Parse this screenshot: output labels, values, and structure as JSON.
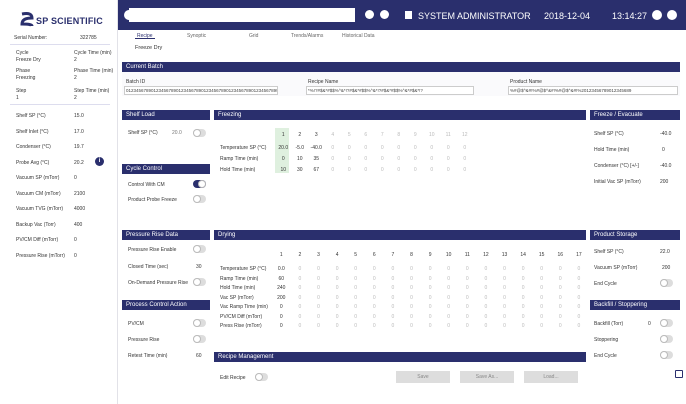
{
  "brand": {
    "name": "SP SCIENTIFIC",
    "serial_label": "Serial Number:",
    "serial_value": "322785"
  },
  "sidebar": {
    "cycle_label": "Cycle",
    "cycle_value": "Freeze Dry",
    "cycle_time_label": "Cycle Time (min)",
    "cycle_time_value": "2",
    "phase_label": "Phase",
    "phase_value": "Freezing",
    "phase_time_label": "Phase Time (min)",
    "phase_time_value": "2",
    "step_label": "Step",
    "step_value": "1",
    "step_time_label": "Step Time (min)",
    "step_time_value": "2",
    "metrics": [
      {
        "label": "Shelf SP (°C)",
        "value": "15.0"
      },
      {
        "label": "Shelf Inlet (°C)",
        "value": "17.0"
      },
      {
        "label": "Condenser (°C)",
        "value": "19.7"
      },
      {
        "label": "Probe Avg (°C)",
        "value": "20.2"
      },
      {
        "label": "Vacuum SP (mTorr)",
        "value": "0"
      },
      {
        "label": "Vacuum CM (mTorr)",
        "value": "2100"
      },
      {
        "label": "Vacuum TVG (mTorr)",
        "value": "4000"
      },
      {
        "label": "Backup Vac (Torr)",
        "value": "400"
      },
      {
        "label": "PV/CM Diff (mTorr)",
        "value": "0"
      },
      {
        "label": "Pressure Rise (mTorr)",
        "value": "0"
      }
    ]
  },
  "topbar": {
    "user": "SYSTEM ADMINISTRATOR",
    "date": "2018-12-04",
    "time": "13:14:27"
  },
  "tabs": [
    {
      "label": "Recipe"
    },
    {
      "label": "Synoptic"
    },
    {
      "label": "Grid"
    },
    {
      "label": "Trends/Alarms"
    },
    {
      "label": "Historical Data"
    }
  ],
  "subtitle": "Freeze Dry",
  "current_batch": {
    "title": "Current Batch",
    "batch_label": "Batch ID",
    "batch_value": "0123456789012345678901234567890123456789012345678901234567899",
    "recipe_label": "Recipe Name",
    "recipe_value": "*%!?#$&*#$$%^&*!?#$&*#$$%^&*!?#$&*#$$%^&*#$&*!?",
    "product_label": "Product Name",
    "product_value": "%#@$^&#!%#@$^&#!%#@$^&#!%20123456789012345689"
  },
  "shelf_load": {
    "title": "Shelf Load",
    "sp_label": "Shelf SP (°C)",
    "sp_value": "20.0"
  },
  "freezing": {
    "title": "Freezing",
    "steps": [
      "1",
      "2",
      "3",
      "4",
      "5",
      "6",
      "7",
      "8",
      "9",
      "10",
      "11",
      "12"
    ],
    "rows": [
      {
        "label": "Temperature SP (°C)",
        "values": [
          "20.0",
          "-5.0",
          "-40.0",
          "0",
          "0",
          "0",
          "0",
          "0",
          "0",
          "0",
          "0",
          "0"
        ]
      },
      {
        "label": "Ramp Time (min)",
        "values": [
          "0",
          "10",
          "35",
          "0",
          "0",
          "0",
          "0",
          "0",
          "0",
          "0",
          "0",
          "0"
        ]
      },
      {
        "label": "Hold Time (min)",
        "values": [
          "10",
          "30",
          "67",
          "0",
          "0",
          "0",
          "0",
          "0",
          "0",
          "0",
          "0",
          "0"
        ]
      }
    ]
  },
  "freeze_evacuate": {
    "title": "Freeze / Evacuate",
    "sp_label": "Shelf SP (°C)",
    "sp_value": "-40.0",
    "hold_label": "Hold Time (min)",
    "hold_value": "0",
    "cond_label": "Condenser (°C) [+/-]",
    "cond_value": "-40.0",
    "vac_label": "Initial Vac SP (mTorr)",
    "vac_value": "200"
  },
  "cycle_control": {
    "title": "Cycle Control",
    "control_label": "Control With CM",
    "probe_label": "Product Probe Freeze"
  },
  "pressure_rise": {
    "title": "Pressure Rise Data",
    "enable_label": "Pressure Rise Enable",
    "closed_label": "Closed Time (sec)",
    "closed_value": "30",
    "ondemand_label": "On-Demand Pressure Rise"
  },
  "drying": {
    "title": "Drying",
    "steps": [
      "1",
      "2",
      "3",
      "4",
      "5",
      "6",
      "7",
      "8",
      "9",
      "10",
      "11",
      "12",
      "13",
      "14",
      "15",
      "16",
      "17"
    ],
    "rows": [
      {
        "label": "Temperature SP (°C)",
        "values": [
          "0.0",
          "0",
          "0",
          "0",
          "0",
          "0",
          "0",
          "0",
          "0",
          "0",
          "0",
          "0",
          "0",
          "0",
          "0",
          "0",
          "0"
        ]
      },
      {
        "label": "Ramp Time (min)",
        "values": [
          "60",
          "0",
          "0",
          "0",
          "0",
          "0",
          "0",
          "0",
          "0",
          "0",
          "0",
          "0",
          "0",
          "0",
          "0",
          "0",
          "0"
        ]
      },
      {
        "label": "Hold Time (min)",
        "values": [
          "240",
          "0",
          "0",
          "0",
          "0",
          "0",
          "0",
          "0",
          "0",
          "0",
          "0",
          "0",
          "0",
          "0",
          "0",
          "0",
          "0"
        ]
      },
      {
        "label": "Vac SP (mTorr)",
        "values": [
          "200",
          "0",
          "0",
          "0",
          "0",
          "0",
          "0",
          "0",
          "0",
          "0",
          "0",
          "0",
          "0",
          "0",
          "0",
          "0",
          "0"
        ]
      },
      {
        "label": "Vac Ramp Time (min)",
        "values": [
          "0",
          "0",
          "0",
          "0",
          "0",
          "0",
          "0",
          "0",
          "0",
          "0",
          "0",
          "0",
          "0",
          "0",
          "0",
          "0",
          "0"
        ]
      },
      {
        "label": "PV/CM Diff (mTorr)",
        "values": [
          "0",
          "0",
          "0",
          "0",
          "0",
          "0",
          "0",
          "0",
          "0",
          "0",
          "0",
          "0",
          "0",
          "0",
          "0",
          "0",
          "0"
        ]
      },
      {
        "label": "Press Rise (mTorr)",
        "values": [
          "0",
          "0",
          "0",
          "0",
          "0",
          "0",
          "0",
          "0",
          "0",
          "0",
          "0",
          "0",
          "0",
          "0",
          "0",
          "0",
          "0"
        ]
      }
    ]
  },
  "product_storage": {
    "title": "Product Storage",
    "sp_label": "Shelf SP (°C)",
    "sp_value": "22.0",
    "vac_label": "Vacuum SP (mTorr)",
    "vac_value": "200",
    "endcycle_label": "End Cycle"
  },
  "process_control": {
    "title": "Process Control Action",
    "pvcm_label": "PV/CM",
    "pressure_label": "Pressure Rise",
    "retest_label": "Retest Time (min)",
    "retest_value": "60"
  },
  "backfill": {
    "title": "Backfill / Stoppering",
    "backfill_label": "Backfill (Torr)",
    "backfill_value": "0",
    "stoppering_label": "Stoppering",
    "endcycle_label": "End Cycle"
  },
  "recipe_mgmt": {
    "title": "Recipe Management",
    "edit_label": "Edit Recipe",
    "save_label": "Save",
    "saveas_label": "Save As...",
    "load_label": "Load..."
  },
  "colors": {
    "navy": "#2a2f6d",
    "highlight": "#dff0df"
  }
}
